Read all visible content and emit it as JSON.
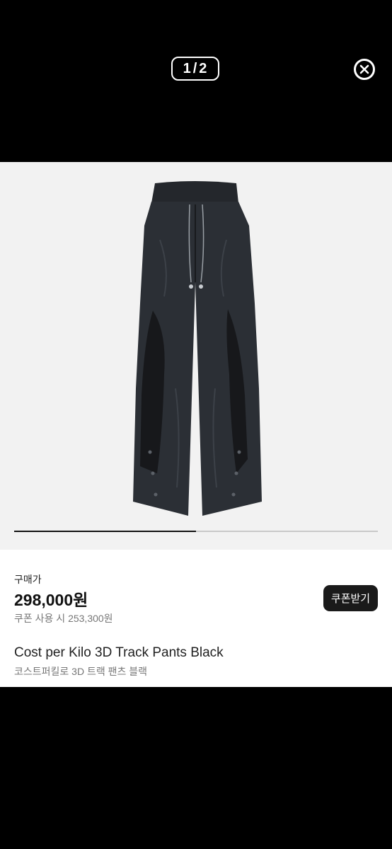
{
  "viewer": {
    "current": "1",
    "separator": "/",
    "total": "2",
    "progress": 0.5
  },
  "product": {
    "price_label": "구매가",
    "price": "298,000원",
    "coupon_price_text": "쿠폰 사용 시 253,300원",
    "coupon_button_label": "쿠폰받기",
    "name_en": "Cost per Kilo 3D Track Pants Black",
    "name_ko": "코스트퍼킬로 3D 트랙 팬츠 블랙"
  },
  "colors": {
    "background": "#000000",
    "image_bg": "#f2f2f2",
    "button_bg": "#1a1a1a"
  }
}
